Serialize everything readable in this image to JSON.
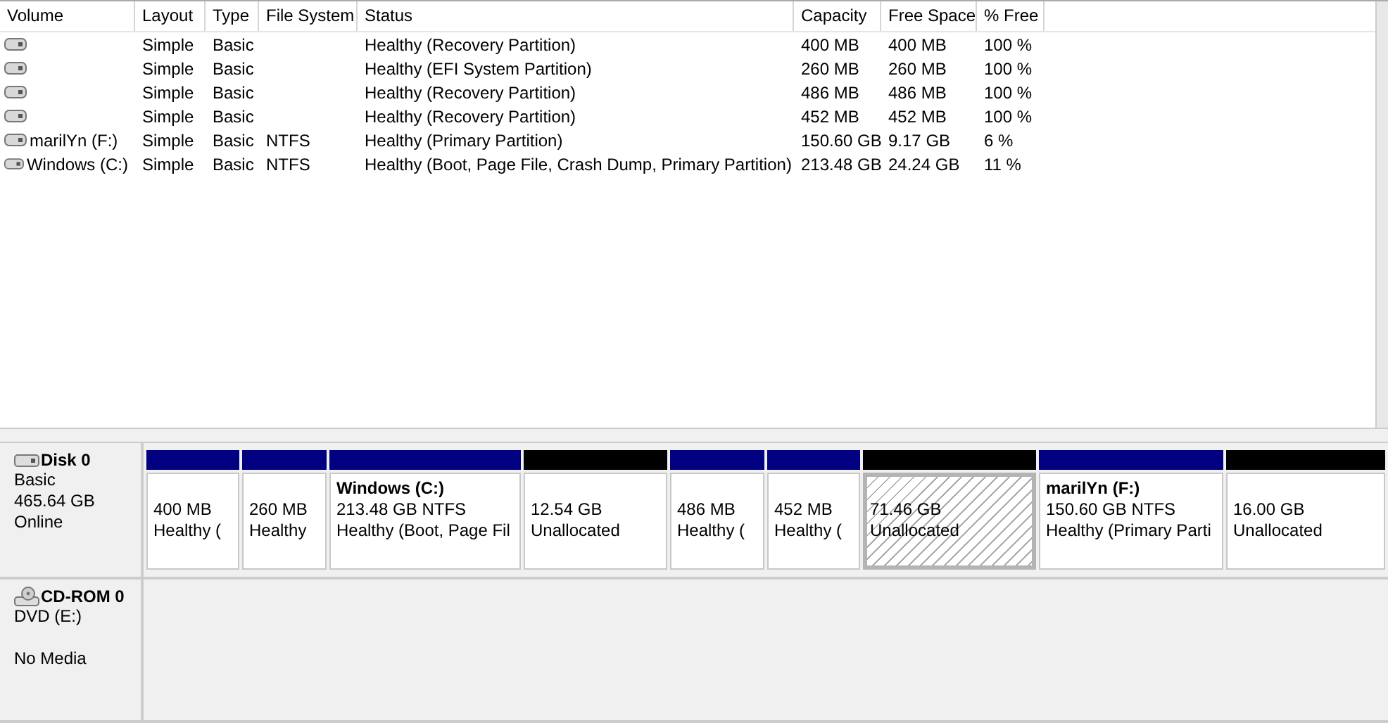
{
  "table": {
    "columns": [
      "Volume",
      "Layout",
      "Type",
      "File System",
      "Status",
      "Capacity",
      "Free Space",
      "% Free"
    ],
    "rows": [
      {
        "cells": [
          "",
          "Simple",
          "Basic",
          "",
          "Healthy (Recovery Partition)",
          "400 MB",
          "400 MB",
          "100 %"
        ]
      },
      {
        "cells": [
          "",
          "Simple",
          "Basic",
          "",
          "Healthy (EFI System Partition)",
          "260 MB",
          "260 MB",
          "100 %"
        ]
      },
      {
        "cells": [
          "",
          "Simple",
          "Basic",
          "",
          "Healthy (Recovery Partition)",
          "486 MB",
          "486 MB",
          "100 %"
        ]
      },
      {
        "cells": [
          "",
          "Simple",
          "Basic",
          "",
          "Healthy (Recovery Partition)",
          "452 MB",
          "452 MB",
          "100 %"
        ]
      },
      {
        "cells": [
          "marilYn (F:)",
          "Simple",
          "Basic",
          "NTFS",
          "Healthy (Primary Partition)",
          "150.60 GB",
          "9.17 GB",
          "6 %"
        ]
      },
      {
        "cells": [
          "Windows (C:)",
          "Simple",
          "Basic",
          "NTFS",
          "Healthy (Boot, Page File, Crash Dump, Primary Partition)",
          "213.48 GB",
          "24.24 GB",
          "11 %"
        ]
      }
    ]
  },
  "disks": [
    {
      "kind": "disk",
      "name": "Disk 0",
      "info": [
        "Basic",
        "465.64 GB",
        "Online"
      ],
      "partitions": [
        {
          "kind": "primary",
          "selected": false,
          "size": "400 MB",
          "status": "Healthy ("
        },
        {
          "kind": "primary",
          "selected": false,
          "size": "260 MB",
          "status": "Healthy"
        },
        {
          "kind": "primary",
          "selected": false,
          "name": "Windows  (C:)",
          "size": "213.48 GB NTFS",
          "status": "Healthy (Boot, Page Fil"
        },
        {
          "kind": "unallocated",
          "selected": false,
          "size": "12.54 GB",
          "status": "Unallocated"
        },
        {
          "kind": "primary",
          "selected": false,
          "size": "486 MB",
          "status": "Healthy ("
        },
        {
          "kind": "primary",
          "selected": false,
          "size": "452 MB",
          "status": "Healthy ("
        },
        {
          "kind": "unallocated",
          "selected": true,
          "size": "71.46 GB",
          "status": "Unallocated"
        },
        {
          "kind": "primary",
          "selected": false,
          "name": "marilYn  (F:)",
          "size": "150.60 GB NTFS",
          "status": "Healthy (Primary Parti"
        },
        {
          "kind": "unallocated",
          "selected": false,
          "size": "16.00 GB",
          "status": "Unallocated"
        }
      ]
    },
    {
      "kind": "cdrom",
      "name": "CD-ROM 0",
      "info": [
        "DVD (E:)"
      ],
      "status": "No Media"
    }
  ]
}
